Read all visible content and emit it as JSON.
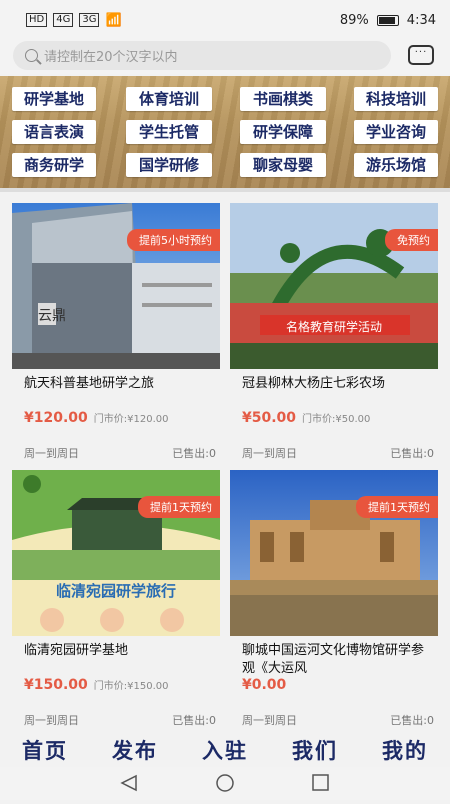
{
  "status": {
    "left_signals": [
      "HD",
      "4G",
      "3G"
    ],
    "battery": "89%",
    "time": "4:34"
  },
  "search": {
    "placeholder": "请控制在20个汉字以内",
    "icon": "search-icon"
  },
  "message_icon": "chat-bubble-icon",
  "categories": [
    "研学基地",
    "体育培训",
    "书画棋类",
    "科技培训",
    "语言表演",
    "学生托管",
    "研学保障",
    "学业咨询",
    "商务研学",
    "国学研修",
    "聊家母婴",
    "游乐场馆"
  ],
  "cards": [
    {
      "badge": "提前5小时预约",
      "title": "航天科普基地研学之旅",
      "price": "¥120.00",
      "market_price": "门市价:¥120.00",
      "days": "周一到周日",
      "sold": "已售出:0"
    },
    {
      "badge": "免预约",
      "title": "冠县柳林大杨庄七彩农场",
      "price": "¥50.00",
      "market_price": "门市价:¥50.00",
      "days": "周一到周日",
      "sold": "已售出:0"
    },
    {
      "badge": "提前1天预约",
      "title": "临清宛园研学基地",
      "price": "¥150.00",
      "market_price": "门市价:¥150.00",
      "days": "周一到周日",
      "sold": "已售出:0"
    },
    {
      "badge": "提前1天预约",
      "title": "聊城中国运河文化博物馆研学参观《大运风",
      "price": "¥0.00",
      "market_price": "",
      "days": "周一到周日",
      "sold": "已售出:0"
    }
  ],
  "card_image_text": {
    "card1_sign": "云鼎",
    "card2_banner": "名格教育研学活动",
    "card3_banner": "临清宛园研学旅行"
  },
  "nav": [
    "首页",
    "发布",
    "入驻",
    "我们",
    "我的"
  ],
  "colors": {
    "accent": "#e45b45",
    "brand": "#1c2a66",
    "badge": "#e8553d"
  }
}
